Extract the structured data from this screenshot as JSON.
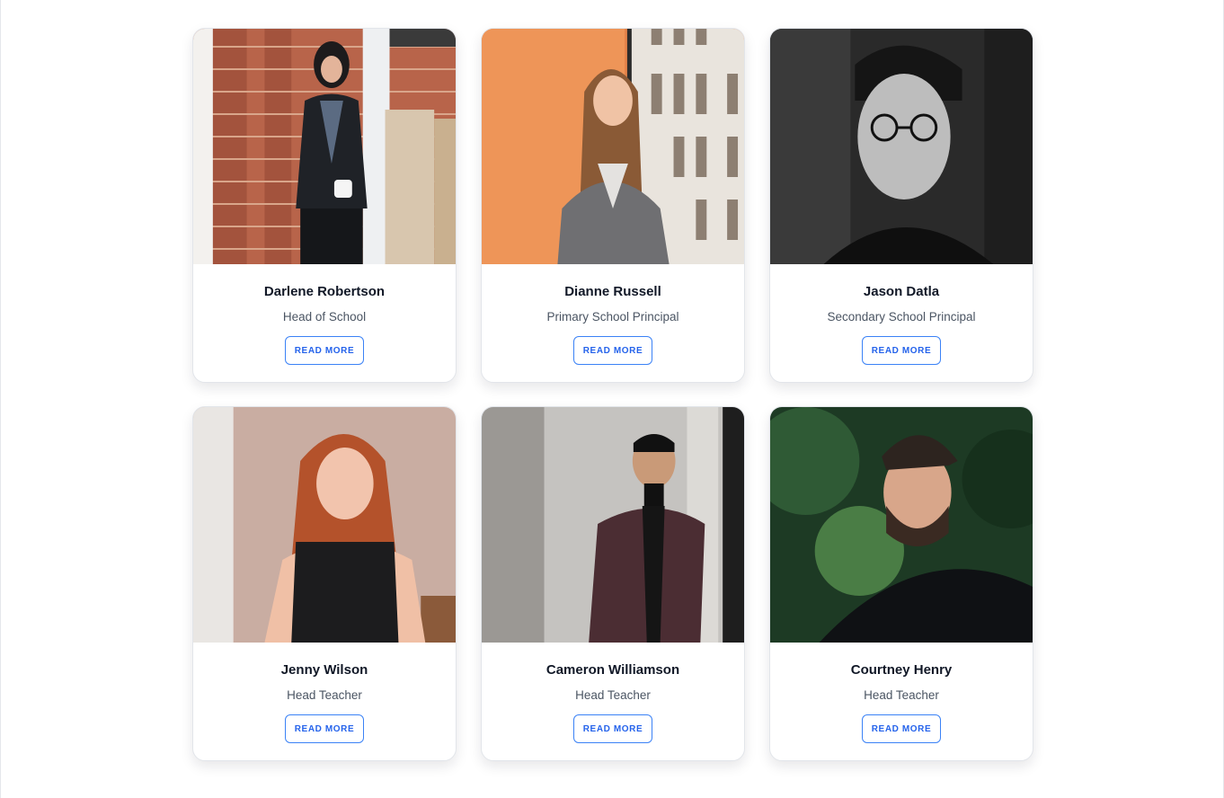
{
  "staff": [
    {
      "name": "Darlene Robertson",
      "role": "Head of School",
      "button": "READ MORE",
      "photo": "woman-brick-wall-photo"
    },
    {
      "name": "Dianne Russell",
      "role": "Primary School Principal",
      "button": "READ MORE",
      "photo": "woman-orange-wall-photo"
    },
    {
      "name": "Jason Datla",
      "role": "Secondary School Principal",
      "button": "READ MORE",
      "photo": "man-glasses-bw-photo"
    },
    {
      "name": "Jenny Wilson",
      "role": "Head Teacher",
      "button": "READ MORE",
      "photo": "woman-red-hair-photo"
    },
    {
      "name": "Cameron Williamson",
      "role": "Head Teacher",
      "button": "READ MORE",
      "photo": "man-suit-photo"
    },
    {
      "name": "Courtney Henry",
      "role": "Head Teacher",
      "button": "READ MORE",
      "photo": "man-beard-forest-photo"
    }
  ],
  "colors": {
    "accent": "#3b82f6",
    "name_text": "#111827",
    "role_text": "#4b5563"
  }
}
